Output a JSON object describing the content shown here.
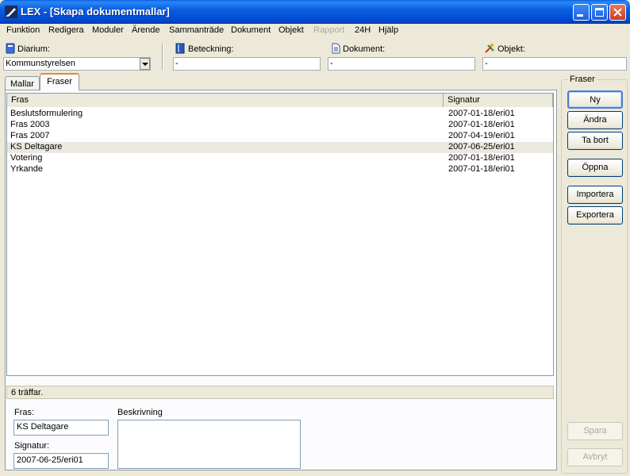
{
  "window": {
    "title": "LEX - [Skapa dokumentmallar]"
  },
  "menu": [
    {
      "label": "Funktion",
      "enabled": true
    },
    {
      "label": "Redigera",
      "enabled": true
    },
    {
      "label": "Moduler",
      "enabled": true
    },
    {
      "label": "Ärende",
      "enabled": true
    },
    {
      "label": "Sammanträde",
      "enabled": true
    },
    {
      "label": "Dokument",
      "enabled": true
    },
    {
      "label": "Objekt",
      "enabled": true
    },
    {
      "label": "Rapport",
      "enabled": false
    },
    {
      "label": "24H",
      "enabled": true
    },
    {
      "label": "Hjälp",
      "enabled": true
    }
  ],
  "fields": {
    "diarium": {
      "label": "Diarium:",
      "value": "Kommunstyrelsen"
    },
    "beteckning": {
      "label": "Beteckning:",
      "value": "-"
    },
    "dokument": {
      "label": "Dokument:",
      "value": "-"
    },
    "objekt": {
      "label": "Objekt:",
      "value": "-"
    }
  },
  "tabs": [
    {
      "label": "Mallar",
      "active": false
    },
    {
      "label": "Fraser",
      "active": true
    }
  ],
  "list": {
    "columns": [
      "Fras",
      "Signatur"
    ],
    "rows": [
      {
        "fras": "Beslutsformulering",
        "signatur": "2007-01-18/eri01",
        "selected": false
      },
      {
        "fras": "Fras 2003",
        "signatur": "2007-01-18/eri01",
        "selected": false
      },
      {
        "fras": "Fras 2007",
        "signatur": "2007-04-19/eri01",
        "selected": false
      },
      {
        "fras": "KS Deltagare",
        "signatur": "2007-06-25/eri01",
        "selected": true
      },
      {
        "fras": "Votering",
        "signatur": "2007-01-18/eri01",
        "selected": false
      },
      {
        "fras": "Yrkande",
        "signatur": "2007-01-18/eri01",
        "selected": false
      }
    ]
  },
  "status": "6 träffar.",
  "detail": {
    "fras_label": "Fras:",
    "fras_value": "KS Deltagare",
    "signatur_label": "Signatur:",
    "signatur_value": "2007-06-25/eri01",
    "beskrivning_label": "Beskrivning",
    "beskrivning_value": ""
  },
  "side": {
    "group_label": "Fraser",
    "buttons": {
      "ny": "Ny",
      "andra": "Ändra",
      "ta_bort": "Ta bort",
      "oppna": "Öppna",
      "importera": "Importera",
      "exportera": "Exportera",
      "spara": "Spara",
      "avbryt": "Avbryt"
    }
  },
  "colors": {
    "titlebar": "#0a5fe0",
    "face": "#ece9d8",
    "selected_row": "#ebe9df",
    "active_tab_accent": "#e68b2c"
  },
  "icons": {
    "app": "quill-pen-icon",
    "diarium": "diarium-book-icon",
    "beteckning": "binder-icon",
    "dokument": "document-icon",
    "objekt": "object-tools-icon"
  }
}
